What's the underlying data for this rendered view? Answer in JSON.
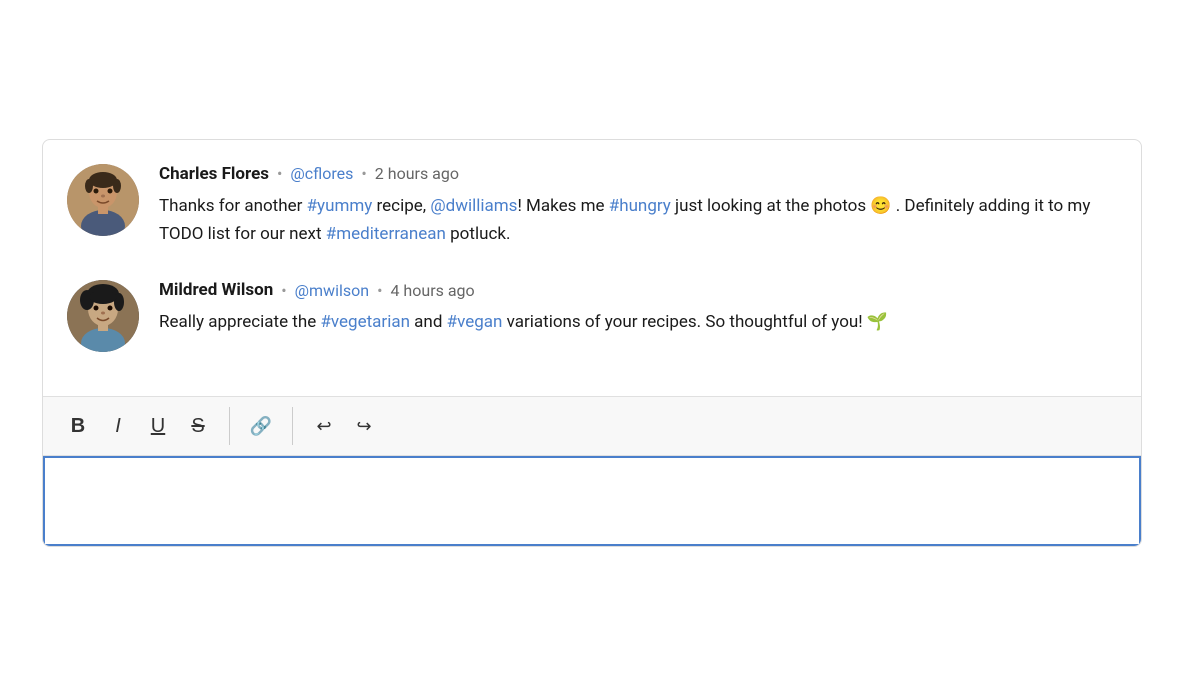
{
  "comments": [
    {
      "id": "comment-1",
      "author": "Charles Flores",
      "username": "@cflores",
      "timestamp": "2 hours ago",
      "avatar_label": "charles-avatar",
      "text_parts": [
        {
          "type": "text",
          "content": "Thanks for another "
        },
        {
          "type": "hashtag",
          "content": "#yummy"
        },
        {
          "type": "text",
          "content": " recipe, "
        },
        {
          "type": "mention",
          "content": "@dwilliams"
        },
        {
          "type": "text",
          "content": "! Makes me "
        },
        {
          "type": "hashtag",
          "content": "#hungry"
        },
        {
          "type": "text",
          "content": " just looking at the photos 😊 . Definitely adding it to my TODO list for our next "
        },
        {
          "type": "hashtag",
          "content": "#mediterranean"
        },
        {
          "type": "text",
          "content": " potluck."
        }
      ]
    },
    {
      "id": "comment-2",
      "author": "Mildred Wilson",
      "username": "@mwilson",
      "timestamp": "4 hours ago",
      "avatar_label": "mildred-avatar",
      "text_parts": [
        {
          "type": "text",
          "content": "Really appreciate the "
        },
        {
          "type": "hashtag",
          "content": "#vegetarian"
        },
        {
          "type": "text",
          "content": " and "
        },
        {
          "type": "hashtag",
          "content": "#vegan"
        },
        {
          "type": "text",
          "content": " variations of your recipes. So thoughtful of you! 🌱"
        }
      ]
    }
  ],
  "toolbar": {
    "bold_label": "B",
    "italic_label": "I",
    "underline_label": "U",
    "strikethrough_label": "S",
    "link_label": "🔗",
    "undo_label": "↩",
    "redo_label": "↪"
  },
  "editor": {
    "placeholder": ""
  },
  "dot_separator": "•"
}
